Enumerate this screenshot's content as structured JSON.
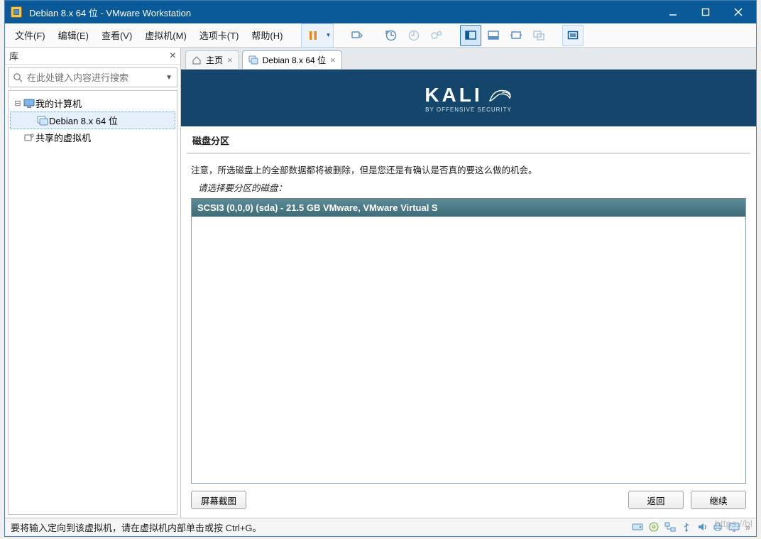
{
  "window": {
    "title": "Debian 8.x 64 位 - VMware Workstation"
  },
  "menu": {
    "file": "文件(F)",
    "edit": "编辑(E)",
    "view": "查看(V)",
    "vm": "虚拟机(M)",
    "tabs": "选项卡(T)",
    "help": "帮助(H)"
  },
  "sidebar": {
    "title": "库",
    "search_placeholder": "在此处键入内容进行搜索",
    "tree": {
      "root": "我的计算机",
      "vm1": "Debian 8.x 64 位",
      "shared": "共享的虚拟机"
    }
  },
  "tabs": {
    "home": "主页",
    "vm": "Debian 8.x 64 位"
  },
  "installer": {
    "brand": "KALI",
    "brand_sub": "BY OFFENSIVE SECURITY",
    "step_title": "磁盘分区",
    "warning": "注意，所选磁盘上的全部数据都将被删除，但是您还是有确认是否真的要这么做的机会。",
    "prompt": "请选择要分区的磁盘：",
    "disk_item": "SCSI3 (0,0,0) (sda) - 21.5 GB VMware, VMware Virtual S",
    "btn_screenshot": "屏幕截图",
    "btn_back": "返回",
    "btn_continue": "继续"
  },
  "statusbar": {
    "text": "要将输入定向到该虚拟机，请在虚拟机内部单击或按 Ctrl+G。"
  },
  "watermark": "https://bl"
}
